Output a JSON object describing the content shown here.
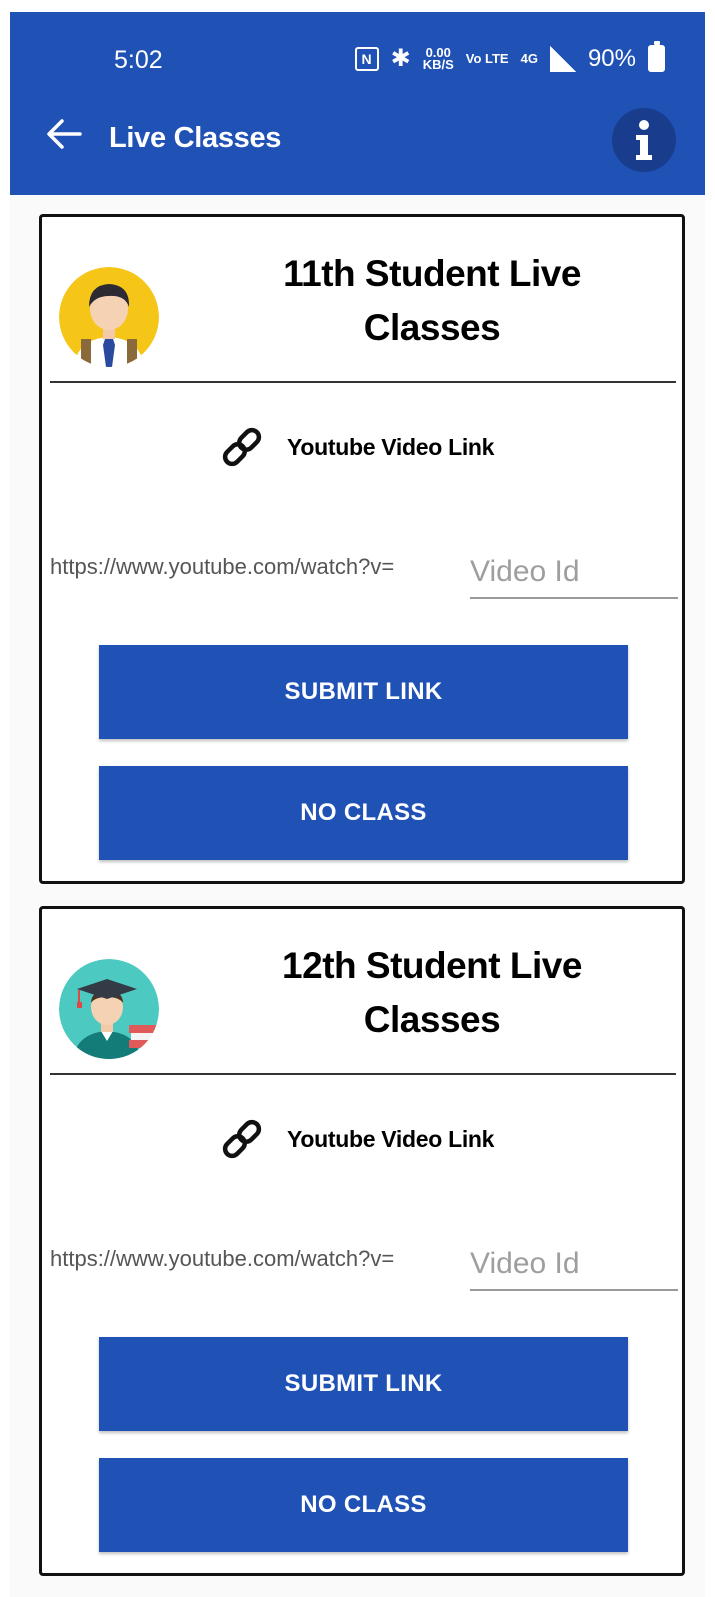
{
  "status_bar": {
    "time": "5:02",
    "nfc": "N",
    "speed_value": "0.00",
    "speed_unit": "KB/S",
    "volte": "Vo LTE",
    "network": "4G",
    "battery": "90%"
  },
  "appbar": {
    "title": "Live Classes",
    "back_icon": "arrow-left-icon",
    "info_icon": "info-icon",
    "color": "#2052b6"
  },
  "cards": [
    {
      "title": "11th Student Live Classes",
      "avatar_icon": "student-avatar-icon",
      "link_label": "Youtube Video Link",
      "url_prefix": "https://www.youtube.com/watch?v=",
      "input_placeholder": "Video Id",
      "input_value": "",
      "submit_label": "SUBMIT LINK",
      "noclass_label": "NO CLASS"
    },
    {
      "title": "12th Student Live Classes",
      "avatar_icon": "graduate-avatar-icon",
      "link_label": "Youtube Video Link",
      "url_prefix": "https://www.youtube.com/watch?v=",
      "input_placeholder": "Video Id",
      "input_value": "",
      "submit_label": "SUBMIT LINK",
      "noclass_label": "NO CLASS"
    }
  ]
}
